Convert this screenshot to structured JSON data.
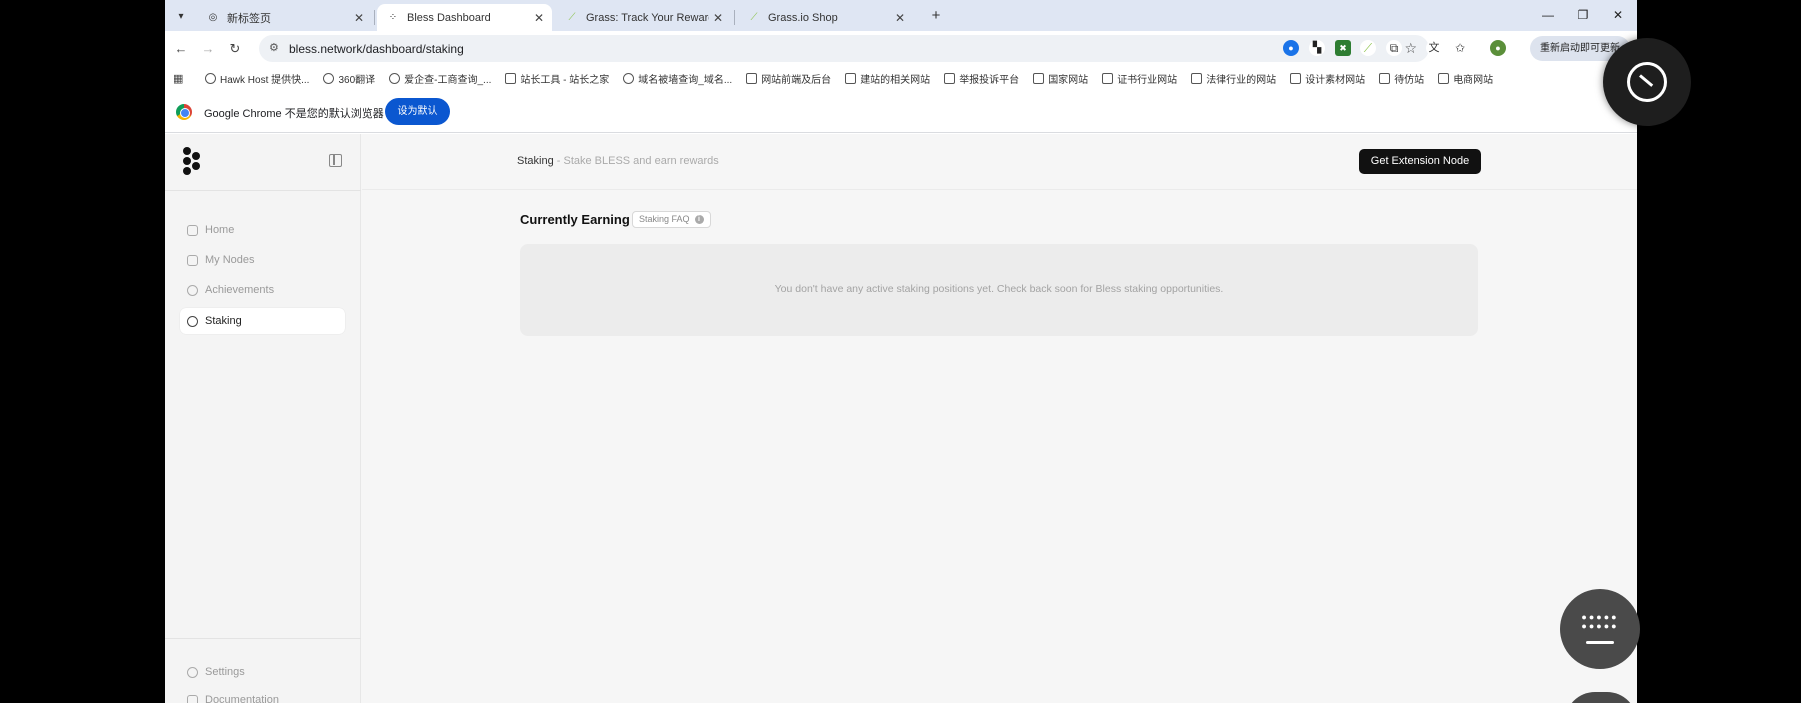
{
  "tabs": [
    {
      "label": "新标签页",
      "active": false
    },
    {
      "label": "Bless Dashboard",
      "active": true
    },
    {
      "label": "Grass: Track Your Rewards",
      "active": false
    },
    {
      "label": "Grass.io Shop",
      "active": false
    }
  ],
  "toolbar": {
    "url": "bless.network/dashboard/staking",
    "update_label": "重新启动即可更新"
  },
  "bookmarks": [
    "Hawk Host 提供快...",
    "360翻译",
    "爱企查-工商查询_...",
    "站长工具 - 站长之家",
    "域名被墙查询_域名...",
    "网站前端及后台",
    "建站的相关网站",
    "举报投诉平台",
    "国家网站",
    "证书行业网站",
    "法律行业的网站",
    "设计素材网站",
    "待仿站",
    "电商网站"
  ],
  "infobar": {
    "text": "Google Chrome 不是您的默认浏览器",
    "button": "设为默认"
  },
  "sidebar": {
    "items": [
      {
        "label": "Home",
        "icon": "home-icon"
      },
      {
        "label": "My Nodes",
        "icon": "nodes-icon"
      },
      {
        "label": "Achievements",
        "icon": "trophy-icon"
      },
      {
        "label": "Staking",
        "icon": "staking-icon",
        "active": true
      }
    ],
    "bottom_items": [
      {
        "label": "Settings",
        "icon": "gear-icon"
      },
      {
        "label": "Documentation",
        "icon": "doc-icon"
      }
    ]
  },
  "main": {
    "breadcrumb_title": "Staking",
    "breadcrumb_sub": " - Stake BLESS and earn rewards",
    "extension_button": "Get Extension Node",
    "section_title": "Currently Earning",
    "faq_badge": "Staking FAQ",
    "empty_message": "You don't have any active staking positions yet. Check back soon for Bless staking opportunities."
  }
}
